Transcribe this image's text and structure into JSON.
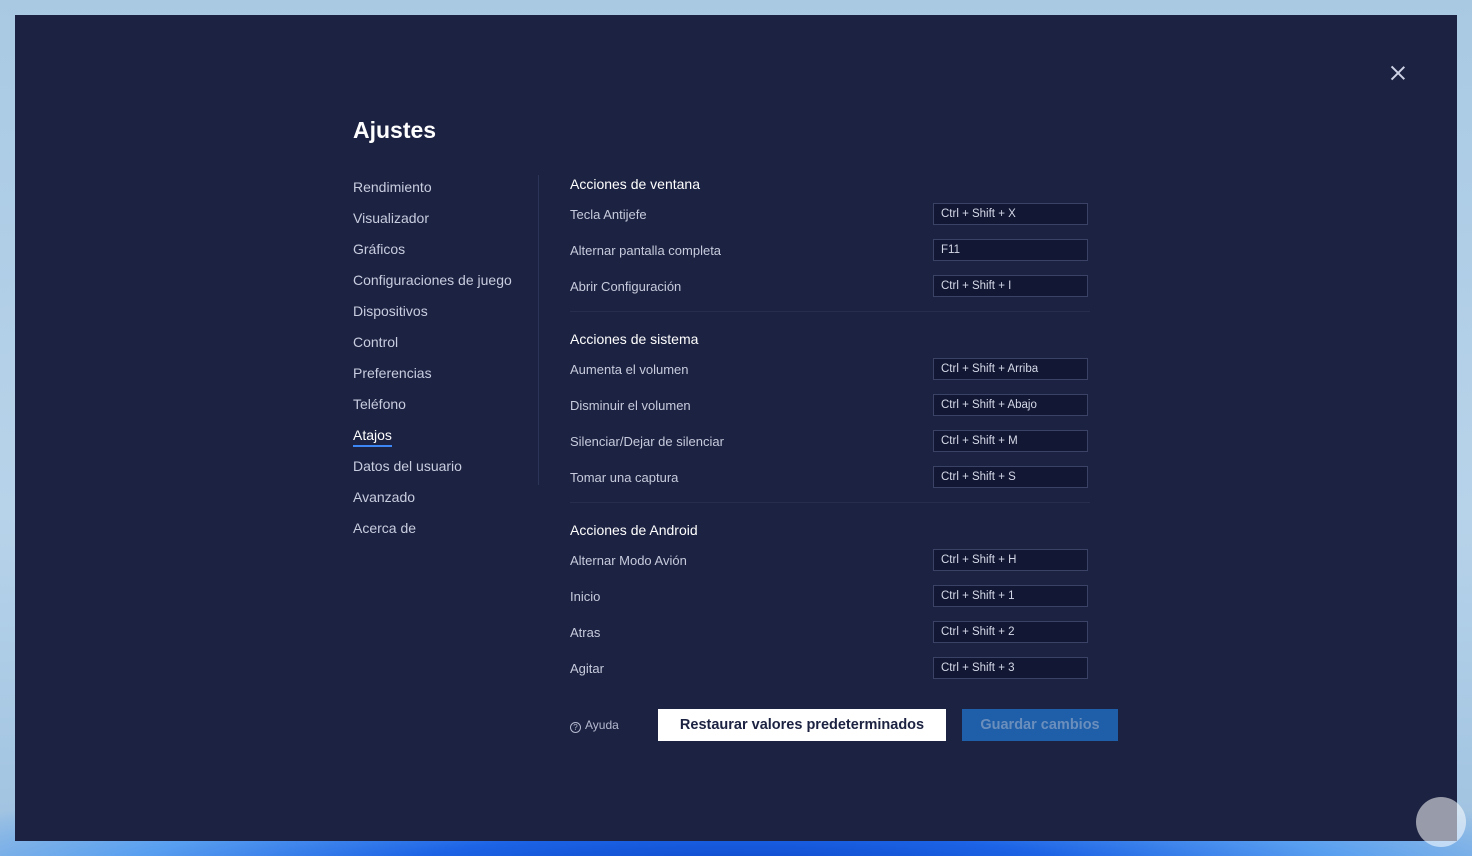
{
  "dialog": {
    "title": "Ajustes"
  },
  "nav": {
    "items": [
      {
        "label": "Rendimiento"
      },
      {
        "label": "Visualizador"
      },
      {
        "label": "Gráficos"
      },
      {
        "label": "Configuraciones de juego"
      },
      {
        "label": "Dispositivos"
      },
      {
        "label": "Control"
      },
      {
        "label": "Preferencias"
      },
      {
        "label": "Teléfono"
      },
      {
        "label": "Atajos",
        "active": true
      },
      {
        "label": "Datos del usuario"
      },
      {
        "label": "Avanzado"
      },
      {
        "label": "Acerca de"
      }
    ]
  },
  "sections": [
    {
      "title": "Acciones de ventana",
      "rows": [
        {
          "label": "Tecla Antijefe",
          "shortcut": "Ctrl + Shift + X"
        },
        {
          "label": "Alternar pantalla completa",
          "shortcut": "F11"
        },
        {
          "label": "Abrir Configuración",
          "shortcut": "Ctrl + Shift + I"
        }
      ]
    },
    {
      "title": "Acciones de sistema",
      "rows": [
        {
          "label": "Aumenta el volumen",
          "shortcut": "Ctrl + Shift + Arriba"
        },
        {
          "label": "Disminuir el volumen",
          "shortcut": "Ctrl + Shift + Abajo"
        },
        {
          "label": "Silenciar/Dejar de silenciar",
          "shortcut": "Ctrl + Shift + M"
        },
        {
          "label": "Tomar una captura",
          "shortcut": "Ctrl + Shift + S"
        }
      ]
    },
    {
      "title": "Acciones de Android",
      "rows": [
        {
          "label": "Alternar Modo Avión",
          "shortcut": "Ctrl + Shift + H"
        },
        {
          "label": "Inicio",
          "shortcut": "Ctrl + Shift + 1"
        },
        {
          "label": "Atras",
          "shortcut": "Ctrl + Shift + 2"
        },
        {
          "label": "Agitar",
          "shortcut": "Ctrl + Shift + 3"
        }
      ]
    }
  ],
  "footer": {
    "help_label": "Ayuda",
    "restore_label": "Restaurar valores predeterminados",
    "save_label": "Guardar cambios"
  },
  "icons": {
    "close": "close-icon",
    "help": "help-circle-icon"
  },
  "colors": {
    "dialog_bg": "#1c2241",
    "accent": "#3d86f5",
    "save_button": "#1f5ea8"
  }
}
